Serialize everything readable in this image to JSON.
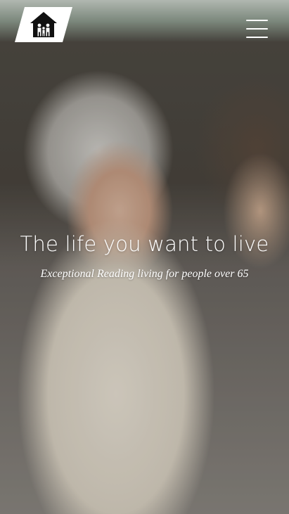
{
  "hero": {
    "image": "elderly-woman-smiling-with-young-woman",
    "headline": "The life you want to live",
    "subheadline": "Exceptional Reading living for people over 65"
  },
  "header": {
    "logo_icon": "house-family-icon",
    "menu_icon": "hamburger-menu-icon"
  },
  "colors": {
    "logo_background": "#ffffff",
    "text": "#ffffff"
  }
}
